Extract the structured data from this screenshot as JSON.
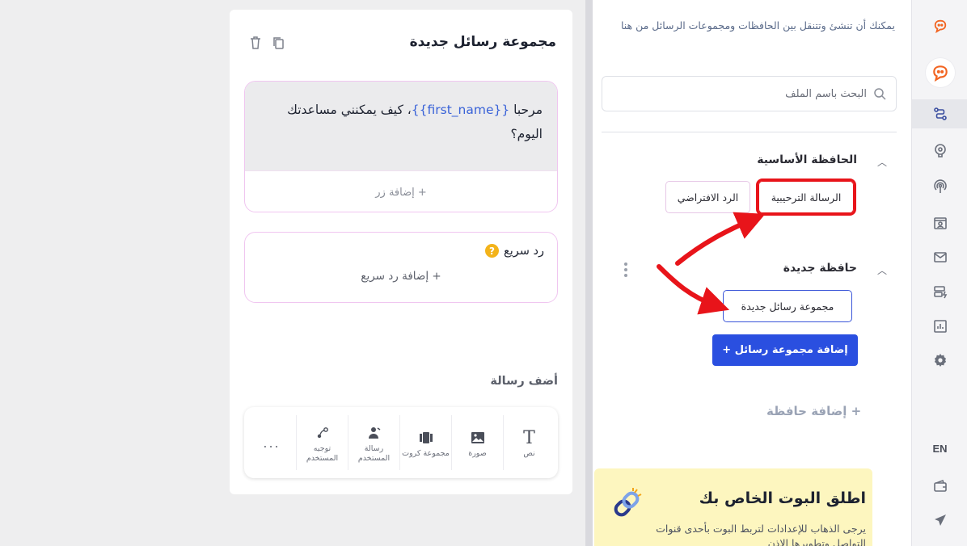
{
  "rail": {
    "lang": "EN",
    "items": [
      "logo-icon",
      "logo-active-icon",
      "flow-icon",
      "brain-icon",
      "broadcast-icon",
      "contacts-icon",
      "mail-icon",
      "templates-icon",
      "analytics-icon",
      "settings-icon",
      "wallet-icon",
      "send-icon"
    ]
  },
  "panel": {
    "intro": "يمكنك أن تنشئ وتتنقل بين الحافظات ومجموعات الرسائل من هنا",
    "search_placeholder": "البحث باسم الملف",
    "folders": [
      {
        "title": "الحافظة الأساسية",
        "items": [
          "الرسالة الترحيبية",
          "الرد الافتراضي"
        ]
      },
      {
        "title": "حافظة جديدة",
        "items": [
          "مجموعة رسائل جديدة"
        ]
      }
    ],
    "add_set_button": "إضافة مجموعة رسائل +",
    "add_folder": "+ إضافة حافظة",
    "promo": {
      "title": "اطلق البوت الخاص بك",
      "text": "يرجى الذهاب للإعدادات لتربط البوت بأحدى قنوات التواصل وتطويرها الإذن"
    }
  },
  "card": {
    "title": "مجموعة رسائل جديدة",
    "message": {
      "prefix": "مرحبا ",
      "variable": "{{first_name}}",
      "suffix": "، كيف يمكنني مساعدتك اليوم؟"
    },
    "add_button": "+ إضافة زر",
    "quick_reply": {
      "title": "رد سريع",
      "add": "+ إضافة رد سريع"
    },
    "add_message_title": "أضف رسالة",
    "tools": [
      {
        "icon": "text-icon",
        "label": "نص"
      },
      {
        "icon": "image-icon",
        "label": "صورة"
      },
      {
        "icon": "cards-icon",
        "label": "مجموعة كروت"
      },
      {
        "icon": "user-input-icon",
        "label": "رسالة المستخدم"
      },
      {
        "icon": "redirect-icon",
        "label": "توجيه المستخدم"
      }
    ],
    "more": "..."
  },
  "colors": {
    "accent": "#2a4fe0",
    "highlight": "#e8141a",
    "promo_bg": "#fdf6bf",
    "brand": "#f26522"
  }
}
